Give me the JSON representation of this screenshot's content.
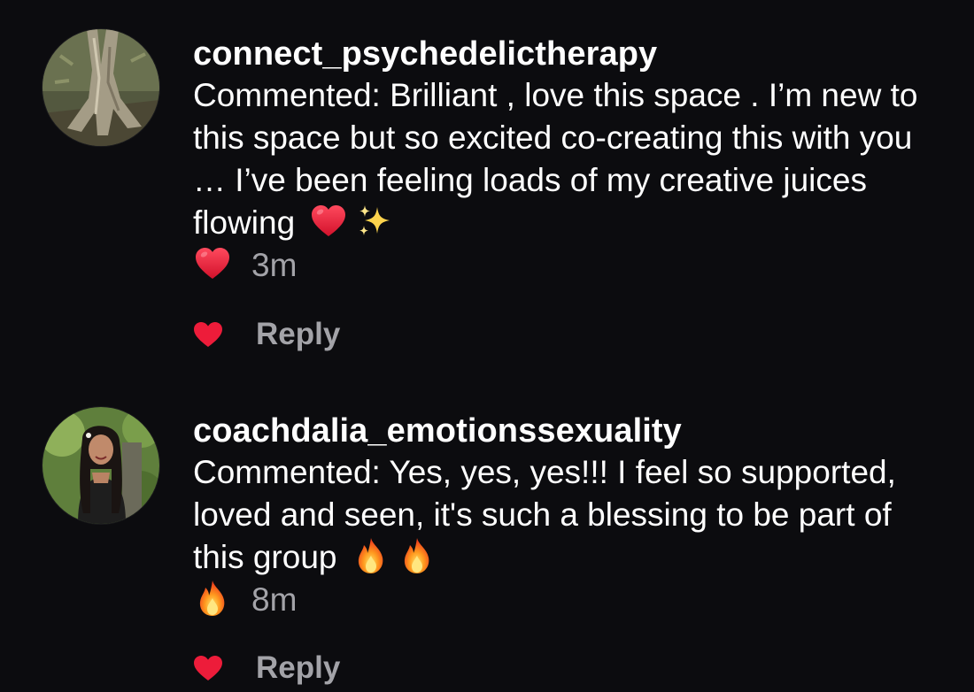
{
  "comments": [
    {
      "username": "connect_psychedelictherapy",
      "avatar_icon": "tree-roots-avatar",
      "text_before_emoji": "Commented: Brilliant , love this space . I’m new to this space but so excited co-creating this with you … I’ve been feeling loads of my creative juices flowing",
      "emojis_inline": [
        "red-heart-icon",
        "sparkles-icon"
      ],
      "emoji_second_line": "red-heart-icon",
      "time": "3m",
      "reply_label": "Reply",
      "like_icon": "heart-icon"
    },
    {
      "username": "coachdalia_emotionssexuality",
      "avatar_icon": "woman-portrait-avatar",
      "text_before_emoji": "Commented: Yes, yes, yes!!! I feel so supported, loved and seen, it's such a blessing to be part of this group",
      "emojis_inline": [
        "fire-icon",
        "fire-icon"
      ],
      "emoji_second_line": "fire-icon",
      "time": "8m",
      "reply_label": "Reply",
      "like_icon": "heart-icon"
    }
  ],
  "colors": {
    "background": "#0c0c0f",
    "text": "#ffffff",
    "muted": "#a3a3a8",
    "like": "#ed1c3a"
  }
}
